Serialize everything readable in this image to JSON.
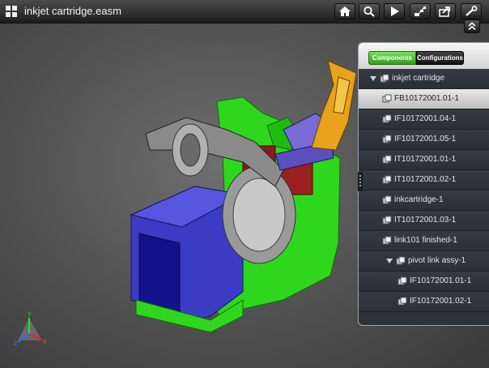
{
  "app": {
    "title": "inkjet cartridge.easm"
  },
  "toolbar": {
    "buttons": [
      {
        "name": "home-button",
        "icon": "home-icon"
      },
      {
        "name": "search-button",
        "icon": "search-icon"
      },
      {
        "name": "play-button",
        "icon": "play-icon"
      },
      {
        "name": "explode-button",
        "icon": "explode-icon"
      },
      {
        "name": "share-button",
        "icon": "share-icon"
      },
      {
        "name": "tools-button",
        "icon": "wrench-icon"
      }
    ]
  },
  "panel": {
    "tabs": [
      {
        "label": "Components",
        "active": true
      },
      {
        "label": "Configurations",
        "active": false
      }
    ],
    "tree": [
      {
        "label": "inkjet cartridge",
        "level": 0,
        "expandable": true,
        "selected": false
      },
      {
        "label": "FB10172001.01-1",
        "level": 1,
        "expandable": false,
        "selected": true
      },
      {
        "label": "IF10172001.04-1",
        "level": 1,
        "expandable": false,
        "selected": false
      },
      {
        "label": "IF10172001.05-1",
        "level": 1,
        "expandable": false,
        "selected": false
      },
      {
        "label": "IT10172001.01-1",
        "level": 1,
        "expandable": false,
        "selected": false
      },
      {
        "label": "IT10172001.02-1",
        "level": 1,
        "expandable": false,
        "selected": false
      },
      {
        "label": "inkcartridge-1",
        "level": 1,
        "expandable": false,
        "selected": false
      },
      {
        "label": "IT10172001.03-1",
        "level": 1,
        "expandable": false,
        "selected": false
      },
      {
        "label": "link101 finished-1",
        "level": 1,
        "expandable": false,
        "selected": false
      },
      {
        "label": "pivot link assy-1",
        "level": 1,
        "expandable": true,
        "selected": false
      },
      {
        "label": "IF10172001.01-1",
        "level": 2,
        "expandable": false,
        "selected": false
      },
      {
        "label": "IF10172001.02-1",
        "level": 2,
        "expandable": false,
        "selected": false
      }
    ]
  },
  "axis": {
    "x_label": "X",
    "y_label": "Y",
    "z_label": "Z"
  },
  "colors": {
    "accent_green": "#3fb52a",
    "selected_row": "#d6d6d6",
    "panel_bg": "#2d3238"
  }
}
